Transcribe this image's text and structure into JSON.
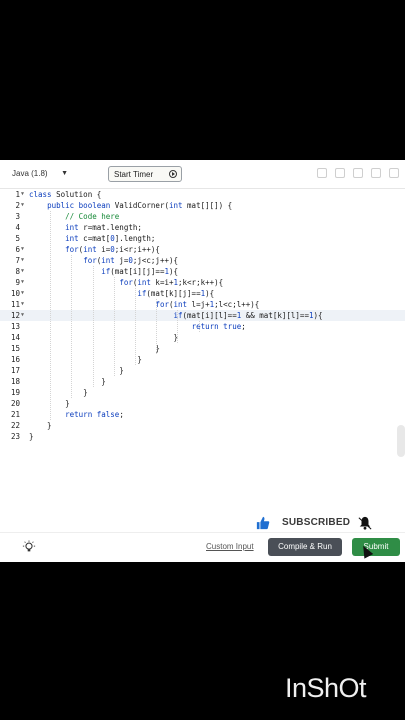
{
  "toolbar": {
    "language": "Java (1.8)",
    "timer_label": "Start Timer"
  },
  "editor": {
    "lines": [
      "class Solution {",
      "    public boolean ValidCorner(int mat[][]) {",
      "        // Code here",
      "        int r=mat.length;",
      "        int c=mat[0].length;",
      "        for(int i=0;i<r;i++){",
      "            for(int j=0;j<c;j++){",
      "                if(mat[i][j]==1){",
      "                    for(int k=i+1;k<r;k++){",
      "                        if(mat[k][j]==1){",
      "                            for(int l=j+1;l<c;l++){",
      "                                if(mat[i][l]==1 && mat[k][l]==1){",
      "                                    return true;",
      "                                }",
      "                            }",
      "                        }",
      "                    }",
      "                }",
      "            }",
      "        }",
      "        return false;",
      "    }",
      "}"
    ],
    "highlighted_line": 12
  },
  "banner": {
    "subscribed_text": "SUBSCRIBED"
  },
  "bottom": {
    "custom_input": "Custom Input",
    "compile_run": "Compile & Run",
    "submit": "Submit"
  },
  "watermark": "InShOt",
  "colors": {
    "submit": "#2f8d46",
    "compile": "#4a4f57",
    "keyword": "#0b3dbd",
    "comment": "#178a38"
  }
}
